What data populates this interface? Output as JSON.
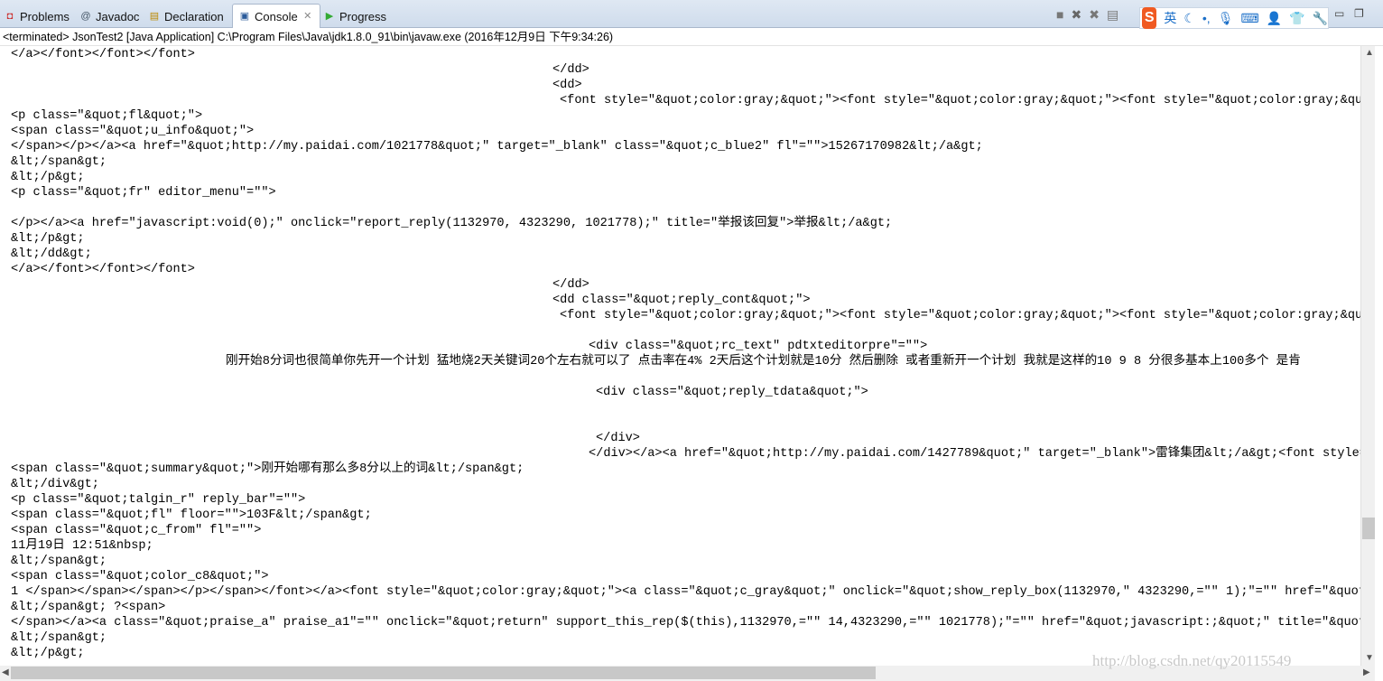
{
  "tabs": [
    {
      "label": "Problems",
      "icon": "problems-icon"
    },
    {
      "label": "Javadoc",
      "icon": "at-icon"
    },
    {
      "label": "Declaration",
      "icon": "declaration-icon"
    },
    {
      "label": "Console",
      "icon": "console-icon",
      "active": true
    },
    {
      "label": "Progress",
      "icon": "progress-icon"
    }
  ],
  "status": "<terminated> JsonTest2 [Java Application] C:\\Program Files\\Java\\jdk1.8.0_91\\bin\\javaw.exe (2016年12月9日 下午9:34:26)",
  "ime": {
    "lang": "英"
  },
  "watermark": "http://blog.csdn.net/qy20115549",
  "lines": [
    "</a></font></font></font>",
    "</dd>",
    "<dd>",
    "<font style=\"&quot;color:gray;&quot;\"><font style=\"&quot;color:gray;&quot;\"><font style=\"&quot;color:gray;&quot;",
    "<p class=\"&quot;fl&quot;\">",
    "<span class=\"&quot;u_info&quot;\">",
    "</span></p></a><a href=\"&quot;http://my.paidai.com/1021778&quot;\" target=\"_blank\" class=\"&quot;c_blue2\" fl\"=\"\">15267170982&lt;/a&gt;",
    "&lt;/span&gt;",
    "&lt;/p&gt;",
    "<p class=\"&quot;fr\" editor_menu\"=\"\">",
    "</p></a><a href=\"javascript:void(0);\" onclick=\"report_reply(1132970, 4323290, 1021778);\" title=\"举报该回复\">举报&lt;/a&gt;",
    "&lt;/p&gt;",
    "&lt;/dd&gt;",
    "</a></font></font></font>",
    "</dd>",
    "<dd class=\"&quot;reply_cont&quot;\">",
    "<font style=\"&quot;color:gray;&quot;\"><font style=\"&quot;color:gray;&quot;\"><font style=\"&quot;color:gray;&quot;",
    "<div class=\"&quot;rc_text\" pdtxteditorpre\"=\"\">",
    "刚开始8分词也很简单你先开一个计划 猛地烧2天关键词20个左右就可以了 点击率在4% 2天后这个计划就是10分 然后删除 或者重新开一个计划 我就是这样的10 9 8 分很多基本上100多个 是肯",
    "<div class=\"&quot;reply_tdata&quot;\">",
    "</div>",
    "</div></a><a href=\"&quot;http://my.paidai.com/1427789&quot;\" target=\"_blank\">雷锋集团&lt;/a&gt;<font style=\"",
    "<span class=\"&quot;summary&quot;\">刚开始哪有那么多8分以上的词&lt;/span&gt;",
    "&lt;/div&gt;",
    "<p class=\"&quot;talgin_r\" reply_bar\"=\"\">",
    "<span class=\"&quot;fl\" floor=\"\">103F&lt;/span&gt;",
    "<span class=\"&quot;c_from\" fl\"=\"\">",
    "11月19日 12:51&nbsp;",
    "&lt;/span&gt;",
    "<span class=\"&quot;color_c8&quot;\">",
    "1 </span></span></span></p></span></font></a><font style=\"&quot;color:gray;&quot;\"><a class=\"&quot;c_gray&quot;\" onclick=\"&quot;show_reply_box(1132970,\" 4323290,=\"\" 1);\"=\"\" href=\"&quot;ja",
    "&lt;/span&gt; ?<span>",
    "</span></a><a class=\"&quot;praise_a\" praise_a1\"=\"\" onclick=\"&quot;return\" support_this_rep($(this),1132970,=\"\" 14,4323290,=\"\" 1021778);\"=\"\" href=\"&quot;javascript:;&quot;\" title=\"&quot;赞",
    "&lt;/span&gt;",
    "&lt;/p&gt;"
  ]
}
